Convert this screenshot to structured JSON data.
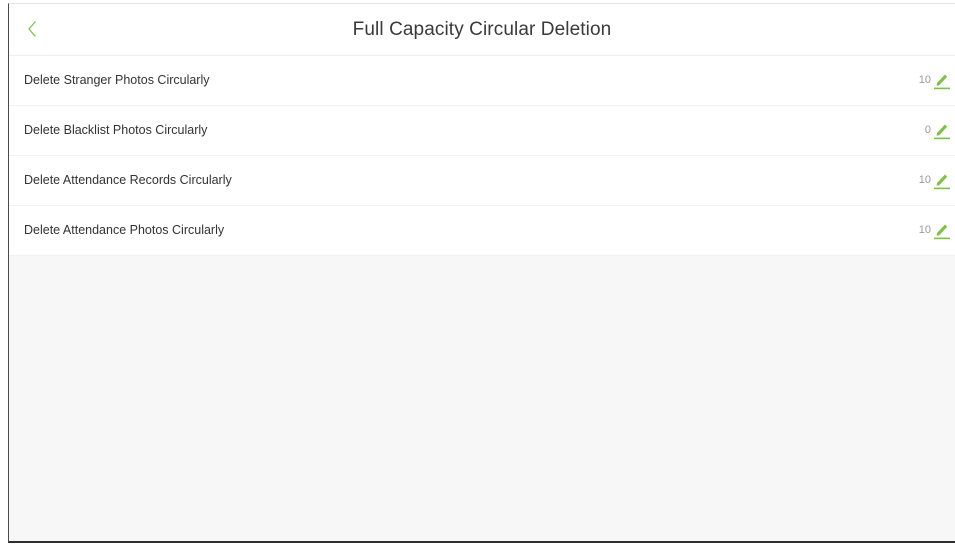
{
  "header": {
    "title": "Full Capacity Circular Deletion",
    "back_icon": "chevron-left-icon"
  },
  "colors": {
    "accent": "#7dc242",
    "background": "#f7f7f7",
    "row_background": "#ffffff"
  },
  "settings": [
    {
      "label": "Delete Stranger Photos Circularly",
      "value": "10",
      "icon": "pencil-icon"
    },
    {
      "label": "Delete Blacklist Photos Circularly",
      "value": "0",
      "icon": "pencil-icon"
    },
    {
      "label": "Delete Attendance Records Circularly",
      "value": "10",
      "icon": "pencil-icon"
    },
    {
      "label": "Delete Attendance Photos Circularly",
      "value": "10",
      "icon": "pencil-icon"
    }
  ]
}
